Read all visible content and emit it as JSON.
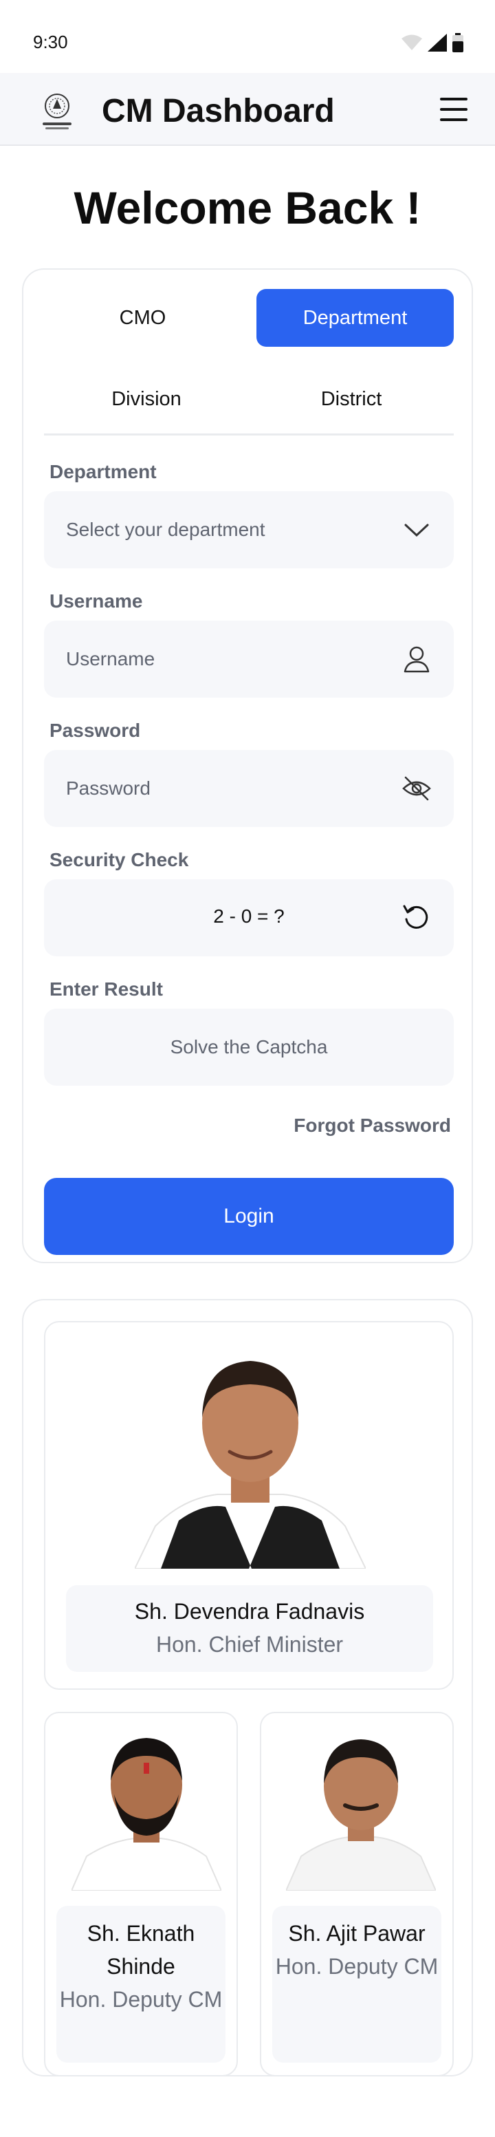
{
  "status_bar": {
    "time": "9:30"
  },
  "header": {
    "title": "CM Dashboard"
  },
  "welcome": "Welcome Back !",
  "tabs": {
    "row1": [
      {
        "label": "CMO",
        "active": false
      },
      {
        "label": "Department",
        "active": true
      }
    ],
    "row2": [
      {
        "label": "Division"
      },
      {
        "label": "District"
      }
    ]
  },
  "form": {
    "department_label": "Department",
    "department_placeholder": "Select your department",
    "username_label": "Username",
    "username_placeholder": "Username",
    "password_label": "Password",
    "password_placeholder": "Password",
    "security_label": "Security Check",
    "captcha_question": "2 - 0 = ?",
    "result_label": "Enter Result",
    "result_placeholder": "Solve the Captcha",
    "forgot": "Forgot Password",
    "login": "Login"
  },
  "leaders": [
    {
      "name": "Sh. Devendra Fadnavis",
      "role": "Hon. Chief Minister"
    },
    {
      "name": "Sh. Eknath Shinde",
      "role": "Hon. Deputy CM"
    },
    {
      "name": "Sh. Ajit Pawar",
      "role": "Hon. Deputy CM"
    }
  ],
  "colors": {
    "accent": "#2a63f0",
    "muted": "#5f6470",
    "field_bg": "#f6f7fa"
  }
}
